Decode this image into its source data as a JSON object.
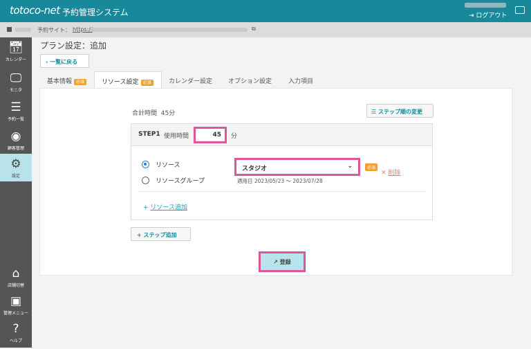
{
  "header": {
    "logo": "totoco-net",
    "system_name": "予約管理システム",
    "logout": "ログアウト"
  },
  "subbar": {
    "site_label": "予約サイト：",
    "url": "https://"
  },
  "sidebar": {
    "items": [
      {
        "label": "カレンダー"
      },
      {
        "label": "モニタ"
      },
      {
        "label": "予約一覧"
      },
      {
        "label": "顧客管理"
      },
      {
        "label": "設定"
      },
      {
        "label": "店舗切替"
      },
      {
        "label": "管理メニュー"
      },
      {
        "label": "ヘルプ"
      }
    ]
  },
  "page": {
    "title": "プラン設定：追加",
    "back": "一覧に戻る"
  },
  "tabs": [
    {
      "label": "基本情報",
      "badge": "必須"
    },
    {
      "label": "リソース設定",
      "badge": "必須"
    },
    {
      "label": "カレンダー設定"
    },
    {
      "label": "オプション設定"
    },
    {
      "label": "入力項目"
    }
  ],
  "form": {
    "total_label": "合計時間",
    "total_value": "45分",
    "order_button": "ステップ順の変更",
    "step_label": "STEP1",
    "use_time_label": "使用時間",
    "use_time_value": "45",
    "unit": "分",
    "radio_resource": "リソース",
    "radio_group": "リソースグループ",
    "resource_value": "スタジオ",
    "required": "必須",
    "delete": "削除",
    "date_range": "適用日 2023/05/23 〜 2023/07/28",
    "add_resource": "リソース追加",
    "add_step": "ステップ追加",
    "register": "登録"
  }
}
